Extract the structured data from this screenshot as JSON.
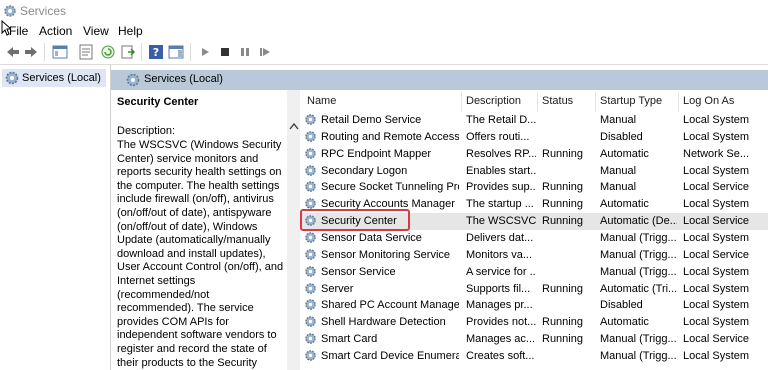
{
  "window": {
    "title": "Services"
  },
  "menu": [
    "File",
    "Action",
    "View",
    "Help"
  ],
  "tree": {
    "root_label": "Services (Local)"
  },
  "pane": {
    "header": "Services (Local)"
  },
  "description": {
    "service_name": "Security Center",
    "label": "Description:",
    "text": "The WSCSVC (Windows Security Center) service monitors and reports security health settings on the computer.  The health settings include firewall (on/off), antivirus (on/off/out of date), antispyware (on/off/out of date), Windows Update (automatically/manually download and install updates), User Account Control (on/off), and Internet settings (recommended/not recommended). The service provides COM APIs for independent software vendors to register and record the state of their products to the Security Center service. The Security and"
  },
  "columns": [
    "Name",
    "Description",
    "Status",
    "Startup Type",
    "Log On As"
  ],
  "rows": [
    {
      "name": "Retail Demo Service",
      "description": "The Retail D...",
      "status": "",
      "startup": "Manual",
      "logon": "Local System"
    },
    {
      "name": "Routing and Remote Access",
      "description": "Offers routi...",
      "status": "",
      "startup": "Disabled",
      "logon": "Local System"
    },
    {
      "name": "RPC Endpoint Mapper",
      "description": "Resolves RP...",
      "status": "Running",
      "startup": "Automatic",
      "logon": "Network Se..."
    },
    {
      "name": "Secondary Logon",
      "description": "Enables start...",
      "status": "",
      "startup": "Manual",
      "logon": "Local System"
    },
    {
      "name": "Secure Socket Tunneling Pro...",
      "description": "Provides sup...",
      "status": "Running",
      "startup": "Manual",
      "logon": "Local Service"
    },
    {
      "name": "Security Accounts Manager",
      "description": "The startup ...",
      "status": "Running",
      "startup": "Automatic",
      "logon": "Local System"
    },
    {
      "name": "Security Center",
      "description": "The WSCSVC...",
      "status": "Running",
      "startup": "Automatic (De...",
      "logon": "Local Service",
      "selected": true
    },
    {
      "name": "Sensor Data Service",
      "description": "Delivers dat...",
      "status": "",
      "startup": "Manual (Trigg...",
      "logon": "Local System"
    },
    {
      "name": "Sensor Monitoring Service",
      "description": "Monitors va...",
      "status": "",
      "startup": "Manual (Trigg...",
      "logon": "Local Service"
    },
    {
      "name": "Sensor Service",
      "description": "A service for ...",
      "status": "",
      "startup": "Manual (Trigg...",
      "logon": "Local System"
    },
    {
      "name": "Server",
      "description": "Supports fil...",
      "status": "Running",
      "startup": "Automatic (Tri...",
      "logon": "Local System"
    },
    {
      "name": "Shared PC Account Manager",
      "description": "Manages pr...",
      "status": "",
      "startup": "Disabled",
      "logon": "Local System"
    },
    {
      "name": "Shell Hardware Detection",
      "description": "Provides not...",
      "status": "Running",
      "startup": "Automatic",
      "logon": "Local System"
    },
    {
      "name": "Smart Card",
      "description": "Manages ac...",
      "status": "Running",
      "startup": "Manual (Trigg...",
      "logon": "Local Service"
    },
    {
      "name": "Smart Card Device Enumerat...",
      "description": "Creates soft...",
      "status": "",
      "startup": "Manual (Trigg...",
      "logon": "Local System"
    }
  ],
  "colors": {
    "header_bar": "#b9c9da",
    "selection": "#e6e6e6",
    "highlight_border": "#d9393e",
    "tree_selection": "#dde6f2"
  }
}
